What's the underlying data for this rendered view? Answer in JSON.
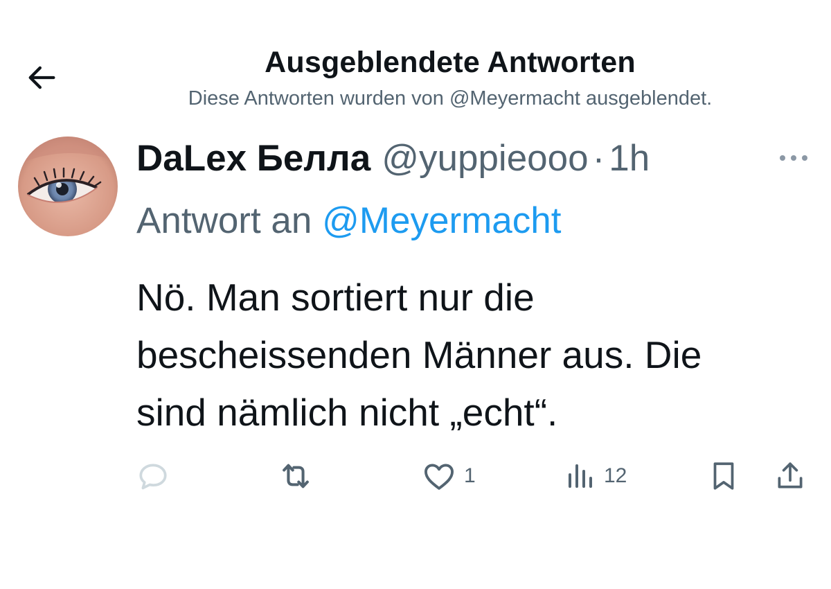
{
  "header": {
    "title": "Ausgeblendete Antworten",
    "subtitle": "Diese Antworten wurden von @Meyermacht ausgeblendet."
  },
  "tweet": {
    "display_name": "DaLex Белла",
    "handle": "@yuppieooo",
    "separator": "·",
    "time": "1h",
    "reply_prefix": "Antwort an",
    "reply_to": "@Meyermacht",
    "text_lines": [
      "Nö. Man sortiert nur die",
      "bescheissenden Männer aus. Die",
      "sind nämlich nicht „echt“."
    ],
    "stats": {
      "likes": "1",
      "views": "12"
    }
  },
  "icons": {
    "back": "arrow-left-icon",
    "more": "more-horizontal-icon",
    "reply": "reply-icon",
    "retweet": "retweet-icon",
    "like": "heart-icon",
    "views": "views-icon",
    "bookmark": "bookmark-icon",
    "share": "share-icon"
  },
  "colors": {
    "text": "#0f1419",
    "muted": "#536471",
    "link": "#1d9bf0",
    "reply_icon_disabled": "#cfd9de"
  }
}
